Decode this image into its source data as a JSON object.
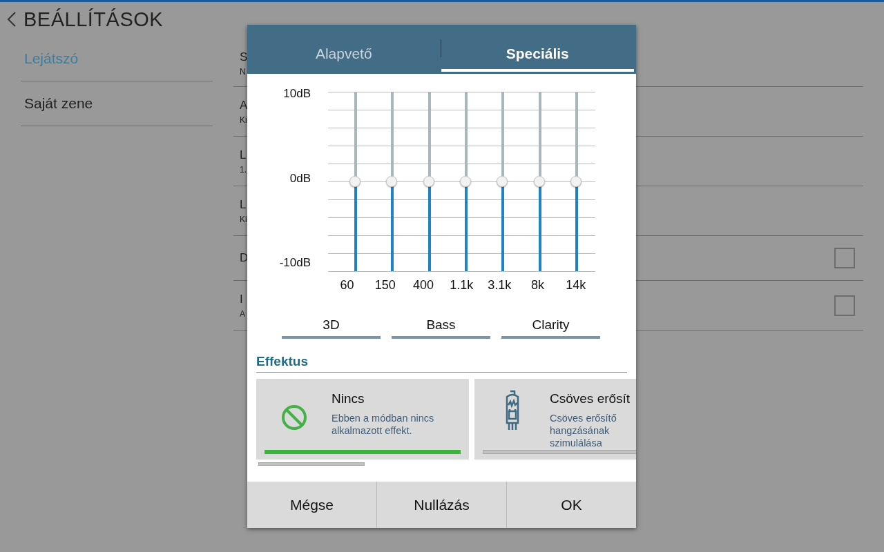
{
  "header": {
    "title": "BEÁLLÍTÁSOK"
  },
  "sidebar": {
    "items": [
      {
        "label": "Lejátszó",
        "selected": true
      },
      {
        "label": "Saját zene",
        "selected": false
      }
    ]
  },
  "settings": [
    {
      "title": "S",
      "subtitle": "N",
      "kind": "text"
    },
    {
      "title": "A",
      "subtitle": "Ki",
      "kind": "text"
    },
    {
      "title": "L",
      "subtitle": "1.",
      "kind": "text"
    },
    {
      "title": "L",
      "subtitle": "Ki",
      "kind": "text"
    },
    {
      "title": "D",
      "kind": "checkbox",
      "checked": false
    },
    {
      "title": "I",
      "subtitle": "A",
      "kind": "checkbox",
      "checked": false
    }
  ],
  "dialog": {
    "tabs": [
      {
        "label": "Alapvető",
        "selected": false
      },
      {
        "label": "Speciális",
        "selected": true
      }
    ],
    "scale": [
      "10dB",
      "0dB",
      "-10dB"
    ],
    "bands": [
      {
        "label": "60",
        "level": 0.5
      },
      {
        "label": "150",
        "level": 0.5
      },
      {
        "label": "400",
        "level": 0.5
      },
      {
        "label": "1.1k",
        "level": 0.5
      },
      {
        "label": "3.1k",
        "level": 0.5
      },
      {
        "label": "8k",
        "level": 0.5
      },
      {
        "label": "14k",
        "level": 0.5
      }
    ],
    "toggles": [
      {
        "label": "3D",
        "on": false
      },
      {
        "label": "Bass",
        "on": false
      },
      {
        "label": "Clarity",
        "on": false
      }
    ],
    "effects_title": "Effektus",
    "effects": [
      {
        "kind": "none",
        "title": "Nincs",
        "description": "Ebben a módban nincs alkalmazott effekt.",
        "selected": true
      },
      {
        "kind": "tube",
        "title": "Csöves erősít",
        "description": "Csöves erősítő hangzásának szimulálása",
        "selected": false
      }
    ],
    "buttons": [
      "Mégse",
      "Nullázás",
      "OK"
    ]
  }
}
